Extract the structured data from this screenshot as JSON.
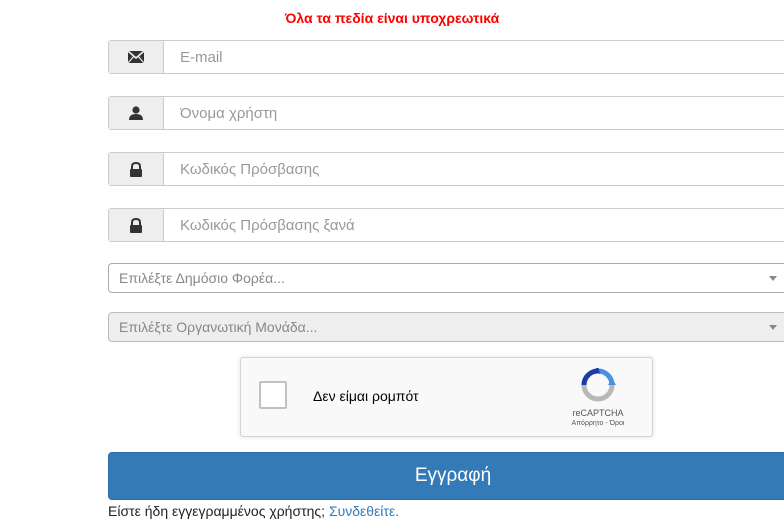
{
  "notice": "Όλα τα πεδία είναι υποχρεωτικά",
  "fields": [
    {
      "icon": "envelope-icon",
      "placeholder": "E-mail"
    },
    {
      "icon": "user-icon",
      "placeholder": "Όνομα χρήστη"
    },
    {
      "icon": "lock-icon",
      "placeholder": "Κωδικός Πρόσβασης"
    },
    {
      "icon": "lock-icon",
      "placeholder": "Κωδικός Πρόσβασης ξανά"
    }
  ],
  "selects": {
    "public_body": "Επιλέξτε Δημόσιο Φορέα...",
    "org_unit": "Επιλέξτε Οργανωτική Μονάδα..."
  },
  "captcha": {
    "label": "Δεν είμαι ρομπότ",
    "brand": "reCAPTCHA",
    "links": "Απόρρητο - Όροι"
  },
  "submit_label": "Εγγραφή",
  "footer": {
    "text": "Είστε ήδη εγγεγραμμένος χρήστης;",
    "link": "Συνδεθείτε."
  },
  "colors": {
    "notice": "#ff0000",
    "primary": "#337ab7",
    "addon_bg": "#eeeeee"
  }
}
